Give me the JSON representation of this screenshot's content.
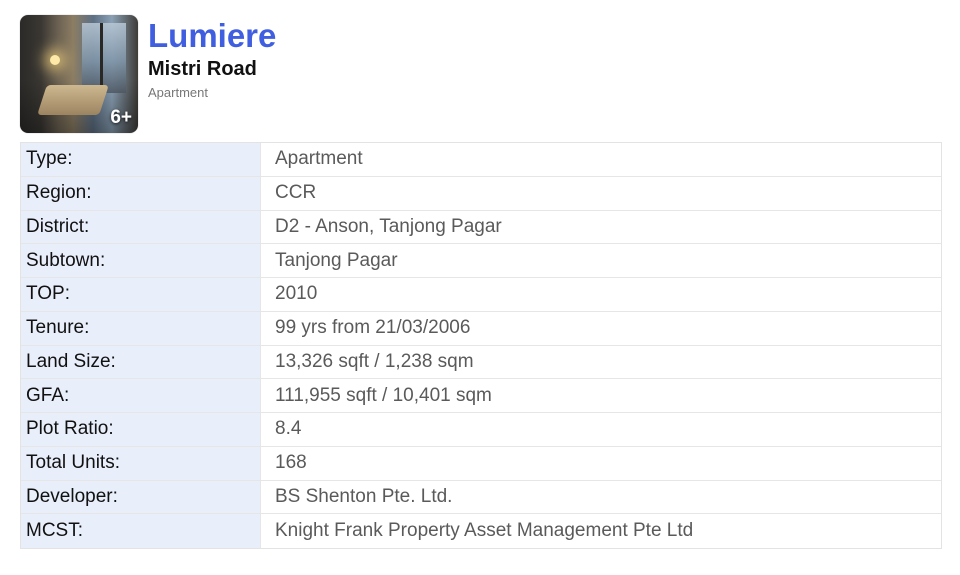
{
  "listing": {
    "name": "Lumiere",
    "street": "Mistri Road",
    "property_type": "Apartment",
    "photo_count": "6+"
  },
  "details": [
    {
      "label": "Type:",
      "value": "Apartment"
    },
    {
      "label": "Region:",
      "value": "CCR"
    },
    {
      "label": "District:",
      "value": "D2 - Anson, Tanjong Pagar"
    },
    {
      "label": "Subtown:",
      "value": "Tanjong Pagar"
    },
    {
      "label": "TOP:",
      "value": "2010"
    },
    {
      "label": "Tenure:",
      "value": "99 yrs from 21/03/2006"
    },
    {
      "label": "Land Size:",
      "value": "13,326 sqft / 1,238 sqm"
    },
    {
      "label": "GFA:",
      "value": "111,955 sqft / 10,401 sqm"
    },
    {
      "label": "Plot Ratio:",
      "value": "8.4"
    },
    {
      "label": "Total Units:",
      "value": "168"
    },
    {
      "label": "Developer:",
      "value": "BS Shenton Pte. Ltd."
    },
    {
      "label": "MCST:",
      "value": "Knight Frank Property Asset Management Pte Ltd"
    }
  ],
  "colors": {
    "title": "#3f5fe0",
    "label_bg": "#e9eefb"
  }
}
